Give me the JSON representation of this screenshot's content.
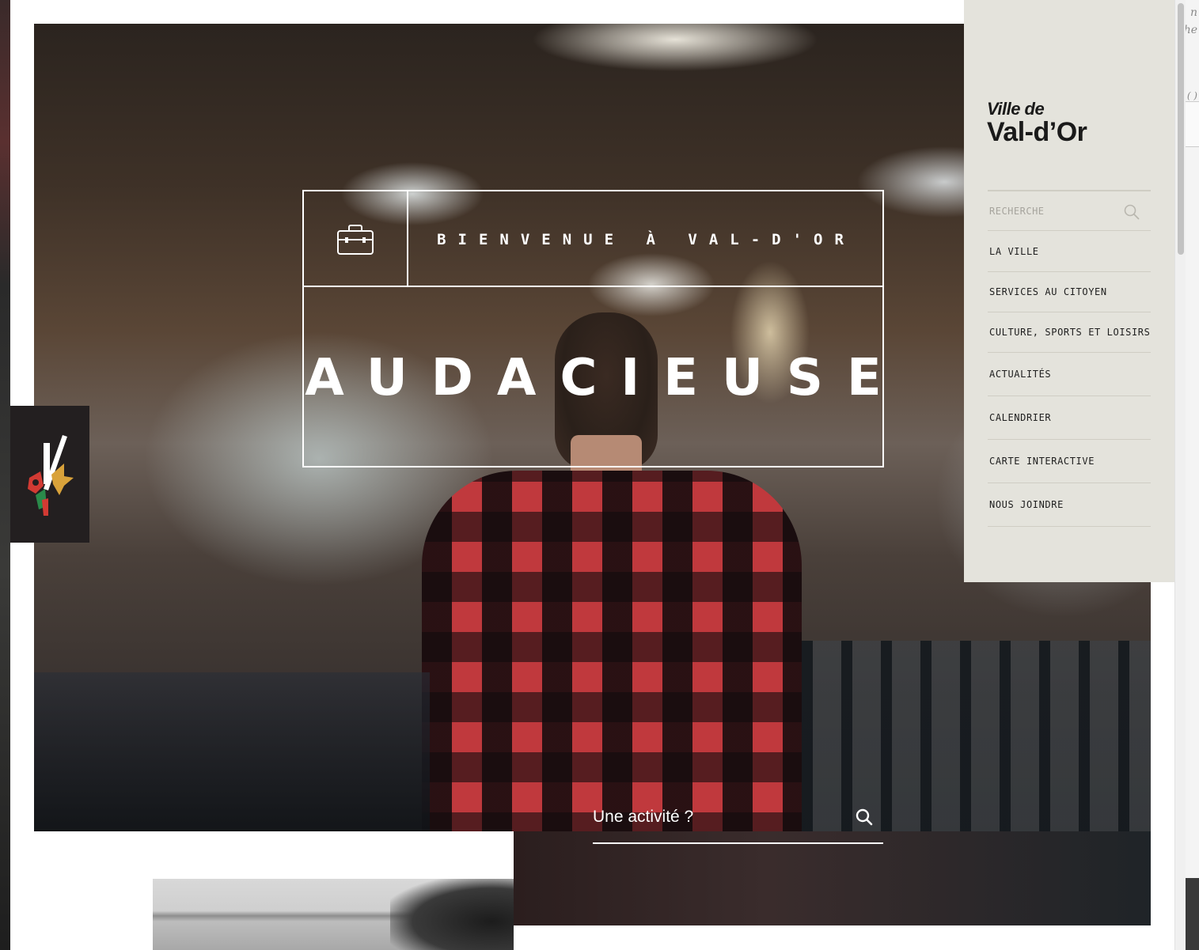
{
  "hero": {
    "tagline": "BIENVENUE À VAL-D'OR",
    "headline": "AUDACIEUSE",
    "activity_placeholder": "Une activité ?"
  },
  "menu": {
    "logo_line1": "Ville de",
    "logo_line2": "Val-d’Or",
    "search_placeholder": "RECHERCHE",
    "items": [
      {
        "label": "LA VILLE"
      },
      {
        "label": "SERVICES AU CITOYEN"
      },
      {
        "label": "CULTURE, SPORTS ET LOISIRS"
      },
      {
        "label": "ACTUALITÉS"
      },
      {
        "label": "CALENDRIER"
      },
      {
        "label": "CARTE INTERACTIVE"
      },
      {
        "label": "NOUS JOINDRE"
      }
    ]
  },
  "background_ghost": {
    "line1": "n",
    "line2": "he",
    "line3": "( )"
  },
  "icons": {
    "welcome": "briefcase-icon",
    "activity_search": "search-icon",
    "menu_search": "search-icon",
    "emblem": "city-emblem-icon"
  },
  "colors": {
    "menu_bg": "#e4e3dc",
    "emblem_bg": "#231f20",
    "text_dark": "#1e1e1e",
    "hero_line": "#ffffff"
  }
}
